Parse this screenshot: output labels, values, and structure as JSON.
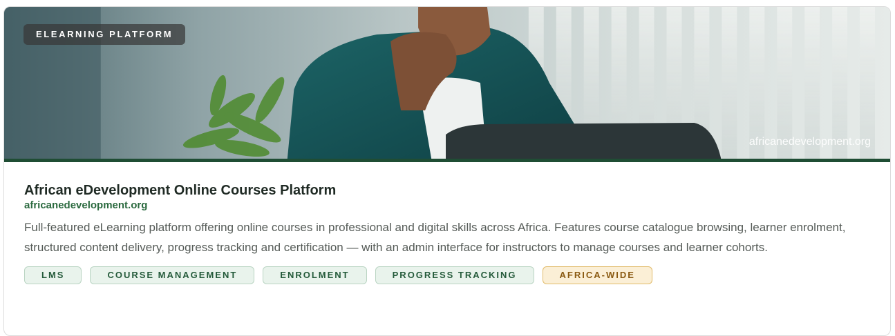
{
  "hero": {
    "badge": "ELEARNING PLATFORM",
    "watermark_url": "africanedevelopment.org",
    "image_description_icon": "person-at-laptop-photo"
  },
  "card": {
    "title": "African eDevelopment Online Courses Platform",
    "link": "africanedevelopment.org",
    "description": "Full-featured eLearning platform offering online courses in professional and digital skills across Africa. Features course catalogue browsing, learner enrolment, structured content delivery, progress tracking and certification — with an admin interface for instructors to manage courses and learner cohorts."
  },
  "tags": [
    "LMS",
    "COURSE MANAGEMENT",
    "ENROLMENT",
    "PROGRESS TRACKING",
    "AFRICA-WIDE"
  ],
  "colors": {
    "brand_green": "#1f4d34",
    "link_green": "#2b6a3f",
    "tag_bg": "#e9f3ec",
    "accent_tag_bg": "#fbefd6",
    "accent_tag_text": "#8a5a12"
  }
}
